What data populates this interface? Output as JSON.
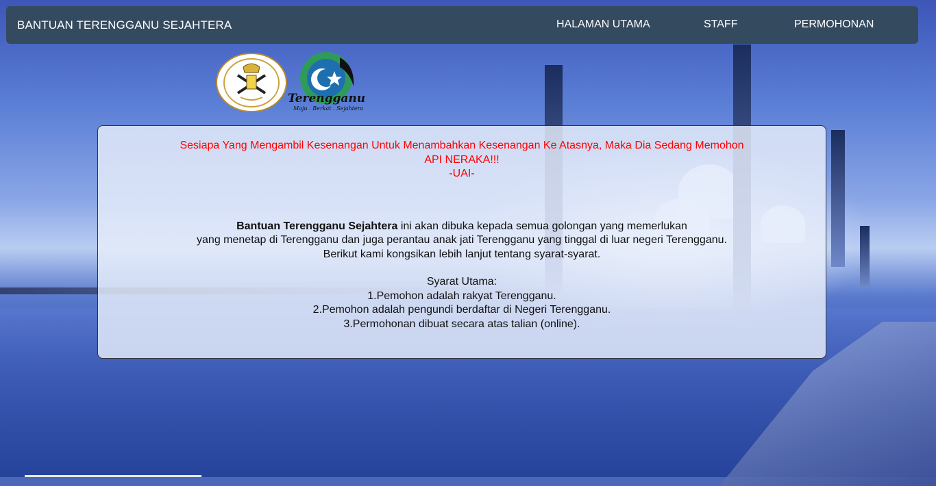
{
  "navbar": {
    "brand": "BANTUAN TERENGGANU SEJAHTERA",
    "links": [
      "HALAMAN UTAMA",
      "STAFF",
      "PERMOHONAN"
    ]
  },
  "logos": {
    "terengganu_text": "Terengganu",
    "terengganu_motto": "Maju . Berkat . Sejahtera"
  },
  "notice": {
    "quote_line1": "Sesiapa Yang Mengambil Kesenangan Untuk Menambahkan Kesenangan Ke Atasnya, Maka Dia Sedang Memohon",
    "quote_line2": "API NERAKA!!!",
    "quote_author": "-UAI-",
    "intro_bold": "Bantuan Terengganu Sejahtera",
    "intro_rest": " ini akan dibuka kepada semua golongan yang memerlukan",
    "intro_line2": "yang menetap di Terengganu dan juga perantau anak jati Terengganu yang tinggal di luar negeri Terengganu.",
    "intro_line3": "Berikut kami kongsikan lebih lanjut tentang syarat-syarat.",
    "requirements_title": "Syarat Utama:",
    "requirements": [
      "1.Pemohon adalah rakyat Terengganu.",
      "2.Pemohon adalah pengundi berdaftar di Negeri Terengganu.",
      "3.Permohonan dibuat secara atas talian (online)."
    ]
  },
  "colors": {
    "navbar": "#344a5f",
    "quote": "#ff0000"
  }
}
